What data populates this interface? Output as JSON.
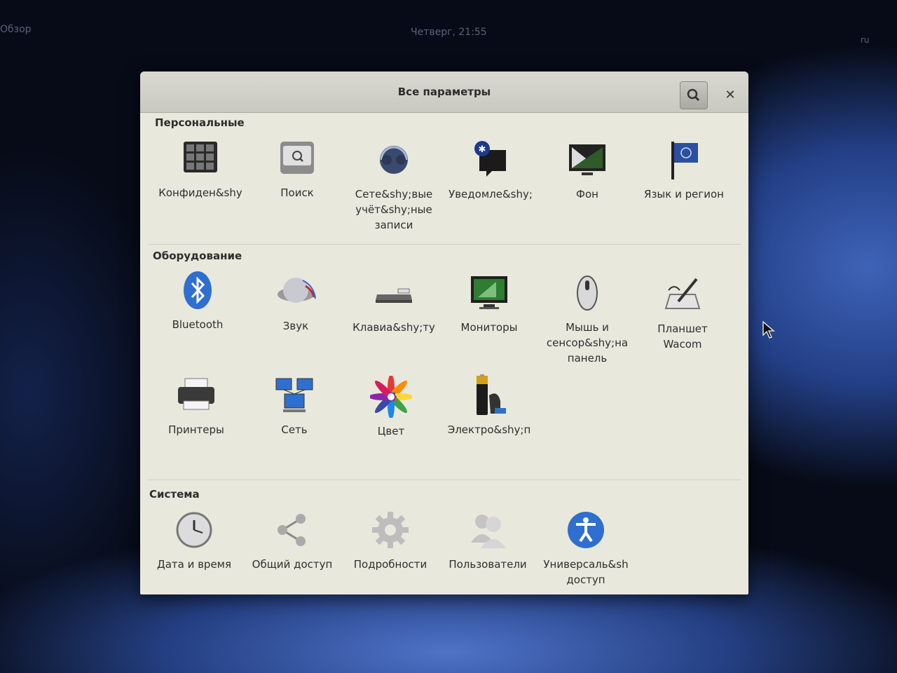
{
  "topbar": {
    "activities": "Обзор",
    "clock": "Четверг, 21:55",
    "system_menu": "ru"
  },
  "window": {
    "title": "Все параметры"
  },
  "sections": {
    "personal": {
      "title": "Персональные",
      "items": [
        {
          "label": "Конфиден&shy"
        },
        {
          "label": "Поиск"
        },
        {
          "label": "Сете&shy;вые\nучёт&shy;ные\nзаписи"
        },
        {
          "label": "Уведомле&shy;"
        },
        {
          "label": "Фон"
        },
        {
          "label": "Язык и регион"
        }
      ]
    },
    "hardware": {
      "title": "Оборудование",
      "items": [
        {
          "label": "Bluetooth"
        },
        {
          "label": "Звук"
        },
        {
          "label": "Клавиа&shy;ту"
        },
        {
          "label": "Мониторы"
        },
        {
          "label": "Мышь и\nсенсор&shy;на\nпанель"
        },
        {
          "label": "Планшет\nWacom"
        },
        {
          "label": "Принтеры"
        },
        {
          "label": "Сеть"
        },
        {
          "label": "Цвет"
        },
        {
          "label": "Электро&shy;п"
        }
      ]
    },
    "system": {
      "title": "Система",
      "items": [
        {
          "label": "Дата и время"
        },
        {
          "label": "Общий доступ"
        },
        {
          "label": "Подробности"
        },
        {
          "label": "Пользователи"
        },
        {
          "label": "Универсаль&sh\nдоступ"
        }
      ]
    }
  },
  "colors": {
    "window_bg": "#e8e8dc",
    "header_bg": "#cfcfc7",
    "accent_blue": "#2f6fcf",
    "desktop_bg": "#070b17"
  }
}
